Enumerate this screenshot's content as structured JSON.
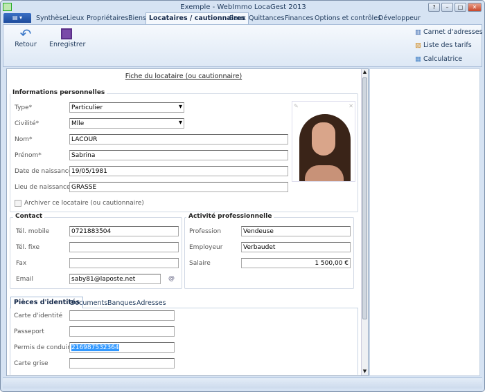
{
  "window": {
    "title": "Exemple - WebImmo LocaGest 2013",
    "buttons": [
      "?",
      "–",
      "□",
      "✕"
    ]
  },
  "tabs": [
    "Synthèse",
    "Lieux",
    "Propriétaires",
    "Biens",
    "Locataires / cautionnaires",
    "Baux",
    "Quittances",
    "Finances",
    "Options et contrôles",
    "Développeur"
  ],
  "active_tab": "Locataires / cautionnaires",
  "ribbon": {
    "back": "Retour",
    "save": "Enregistrer",
    "links": [
      "Carnet d'adresses",
      "Liste des tarifs",
      "Calculatrice"
    ]
  },
  "form": {
    "title": "Fiche du locataire (ou cautionnaire)",
    "personal": {
      "title": "Informations personnelles",
      "type_label": "Type*",
      "type_value": "Particulier",
      "civ_label": "Civilité*",
      "civ_value": "Mlle",
      "nom_label": "Nom*",
      "nom_value": "LACOUR",
      "prenom_label": "Prénom*",
      "prenom_value": "Sabrina",
      "dob_label": "Date de naissance*",
      "dob_value": "19/05/1981",
      "pob_label": "Lieu de naissance*",
      "pob_value": "GRASSE",
      "archive_label": "Archiver ce locataire (ou cautionnaire)",
      "archive_checked": false
    },
    "contact": {
      "title": "Contact",
      "mobile_label": "Tél. mobile",
      "mobile_value": "0721883504",
      "fixe_label": "Tél. fixe",
      "fixe_value": "",
      "fax_label": "Fax",
      "fax_value": "",
      "email_label": "Email",
      "email_value": "saby81@laposte.net"
    },
    "activity": {
      "title": "Activité professionnelle",
      "prof_label": "Profession",
      "prof_value": "Vendeuse",
      "emp_label": "Employeur",
      "emp_value": "Verbaudet",
      "sal_label": "Salaire",
      "sal_value": "1 500,00 €"
    },
    "bottom_tabs": [
      "Pièces d'identités",
      "Documents",
      "Banques",
      "Adresses"
    ],
    "ids": {
      "ci_label": "Carte d'identité",
      "ci_value": "",
      "pass_label": "Passeport",
      "pass_value": "",
      "permis_label": "Permis de conduire",
      "permis_value": "216987532364",
      "grise_label": "Carte grise",
      "grise_value": ""
    }
  },
  "colors": {
    "accent": "#1e395b",
    "selection": "#3399ff"
  }
}
